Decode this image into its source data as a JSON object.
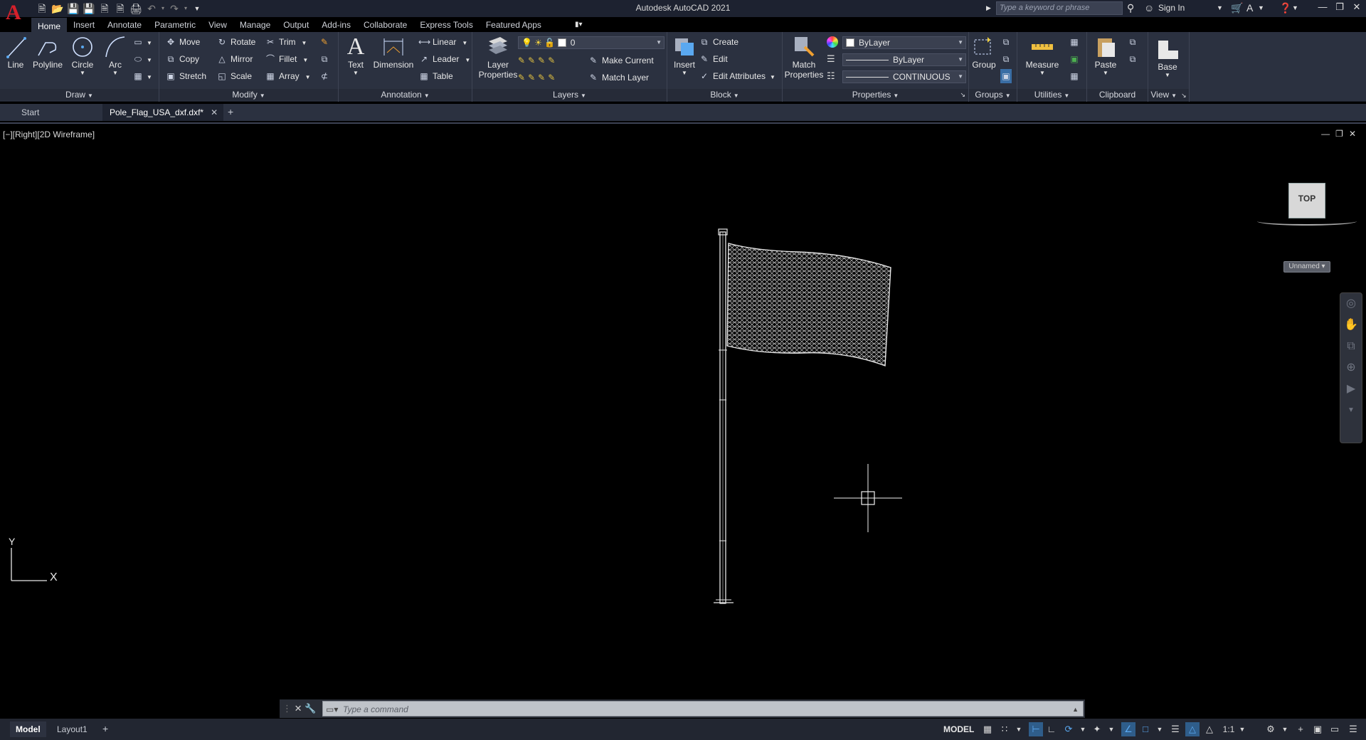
{
  "titlebar": {
    "app_title": "Autodesk AutoCAD 2021",
    "search_placeholder": "Type a keyword or phrase",
    "signin_label": "Sign In"
  },
  "ribbon_tabs": [
    "Home",
    "Insert",
    "Annotate",
    "Parametric",
    "View",
    "Manage",
    "Output",
    "Add-ins",
    "Collaborate",
    "Express Tools",
    "Featured Apps"
  ],
  "active_tab": "Home",
  "panels": {
    "draw": {
      "title": "Draw",
      "big_buttons": [
        "Line",
        "Polyline",
        "Circle",
        "Arc"
      ]
    },
    "modify": {
      "title": "Modify",
      "buttons": [
        "Move",
        "Rotate",
        "Trim",
        "Copy",
        "Mirror",
        "Fillet",
        "Stretch",
        "Scale",
        "Array"
      ]
    },
    "annotation": {
      "title": "Annotation",
      "big_buttons": [
        "Text",
        "Dimension"
      ],
      "buttons": [
        "Linear",
        "Leader",
        "Table"
      ]
    },
    "layers": {
      "title": "Layers",
      "big_button": "Layer Properties",
      "layer_value": "0",
      "buttons": [
        "Make Current",
        "Match Layer"
      ]
    },
    "block": {
      "title": "Block",
      "big_button": "Insert",
      "buttons": [
        "Create",
        "Edit",
        "Edit Attributes"
      ]
    },
    "properties": {
      "title": "Properties",
      "big_button": "Match Properties",
      "color_value": "ByLayer",
      "lineweight_value": "ByLayer",
      "linetype_value": "CONTINUOUS"
    },
    "groups": {
      "title": "Groups",
      "big_button": "Group"
    },
    "utilities": {
      "title": "Utilities",
      "big_button": "Measure"
    },
    "clipboard": {
      "title": "Clipboard",
      "big_button": "Paste"
    },
    "view": {
      "title": "View",
      "big_button": "Base"
    }
  },
  "file_tabs": {
    "start": "Start",
    "active_file": "Pole_Flag_USA_dxf.dxf*"
  },
  "viewport": {
    "label": "[−][Right][2D Wireframe]",
    "viewcube_face": "TOP",
    "wcs_label": "Unnamed",
    "ucs_y": "Y",
    "ucs_x": "X"
  },
  "command": {
    "placeholder": "Type a command"
  },
  "layout_tabs": [
    "Model",
    "Layout1"
  ],
  "status": {
    "model_label": "MODEL",
    "scale_label": "1:1"
  }
}
